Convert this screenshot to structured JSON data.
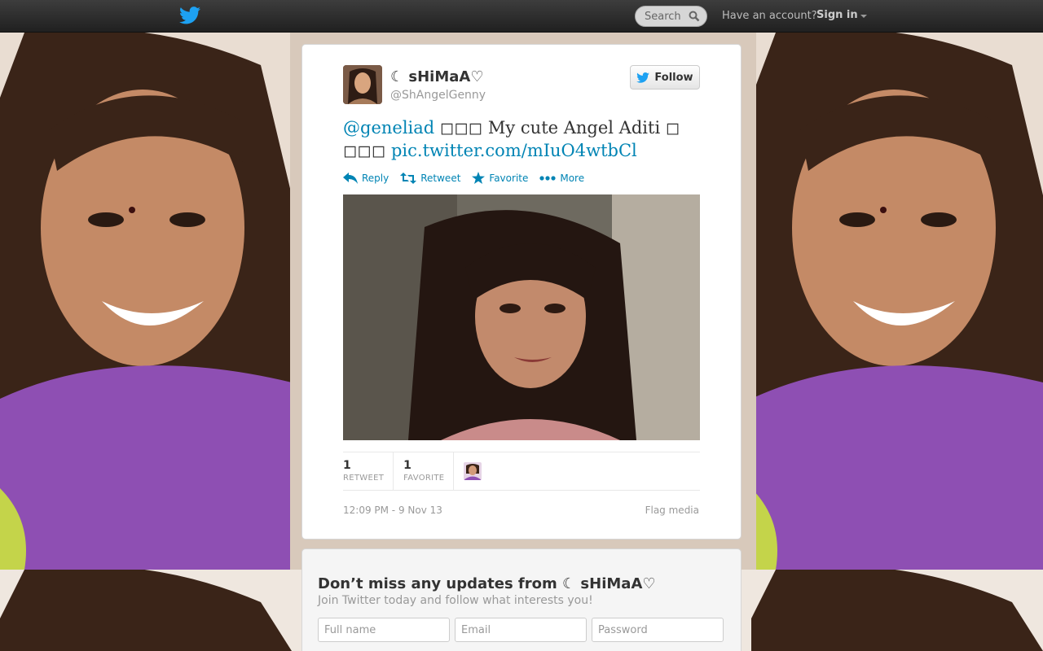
{
  "topbar": {
    "search_placeholder": "Search",
    "have_account": "Have an account?",
    "sign_in": "Sign in"
  },
  "tweet": {
    "display_name": "☾ sHiMaA♡",
    "handle": "@ShAngelGenny",
    "follow_label": "Follow",
    "mention": "@geneliad",
    "text": " ◻◻◻ My cute Angel Aditi ◻ ◻◻◻ ",
    "link": "pic.twitter.com/mIuO4wtbCl",
    "actions": {
      "reply": "Reply",
      "retweet": "Retweet",
      "favorite": "Favorite",
      "more": "More"
    },
    "stats": [
      {
        "count": "1",
        "label": "RETWEET"
      },
      {
        "count": "1",
        "label": "FAVORITE"
      }
    ],
    "timestamp": "12:09 PM - 9 Nov 13",
    "flag_media": "Flag media"
  },
  "signup": {
    "heading": "Don’t miss any updates from ☾ sHiMaA♡",
    "subheading": "Join Twitter today and follow what interests you!",
    "fullname_placeholder": "Full name",
    "email_placeholder": "Email",
    "password_placeholder": "Password"
  },
  "colors": {
    "link": "#0084b4",
    "topbar": "#2b2b2b",
    "twitter_blue": "#1da1f2",
    "background_purple": "#8e4fb3"
  },
  "icons": [
    "twitter-bird-icon",
    "search-icon",
    "reply-icon",
    "retweet-icon",
    "favorite-star-icon",
    "more-dots-icon"
  ]
}
